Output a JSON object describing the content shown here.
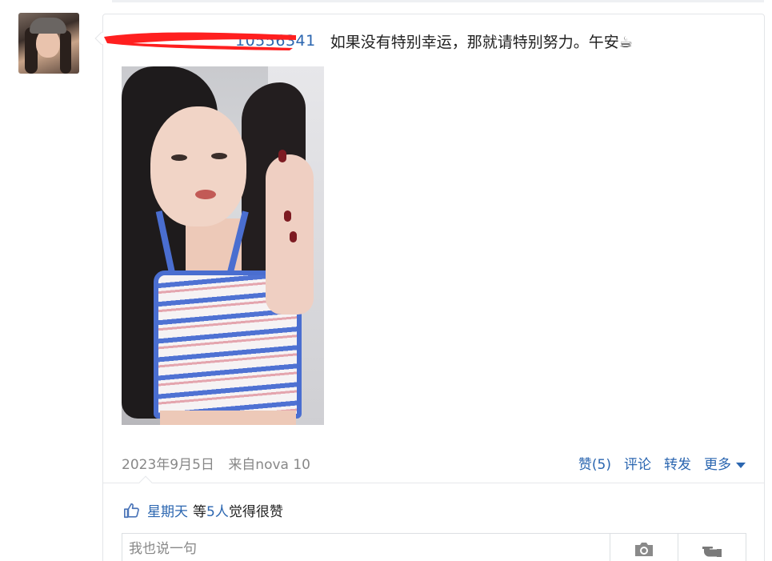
{
  "post": {
    "username": "10556341",
    "text": "如果没有特别幸运，那就请特别努力。午安☕",
    "date": "2023年9月5日",
    "source": "来自nova 10"
  },
  "actions": {
    "like": "赞(5)",
    "comment": "评论",
    "share": "转发",
    "more": "更多"
  },
  "likes": {
    "liker": "星期天",
    "mid": "等",
    "count": "5人",
    "suffix": "觉得很赞"
  },
  "comment_box": {
    "placeholder": "我也说一句"
  },
  "icons": {
    "camera": "camera-icon",
    "thumb": "thumb-up-icon",
    "gesture": "pointing-hand-icon"
  },
  "colors": {
    "link": "#2b66b0",
    "meta": "#888888",
    "redaction": "#ff1f1f"
  }
}
